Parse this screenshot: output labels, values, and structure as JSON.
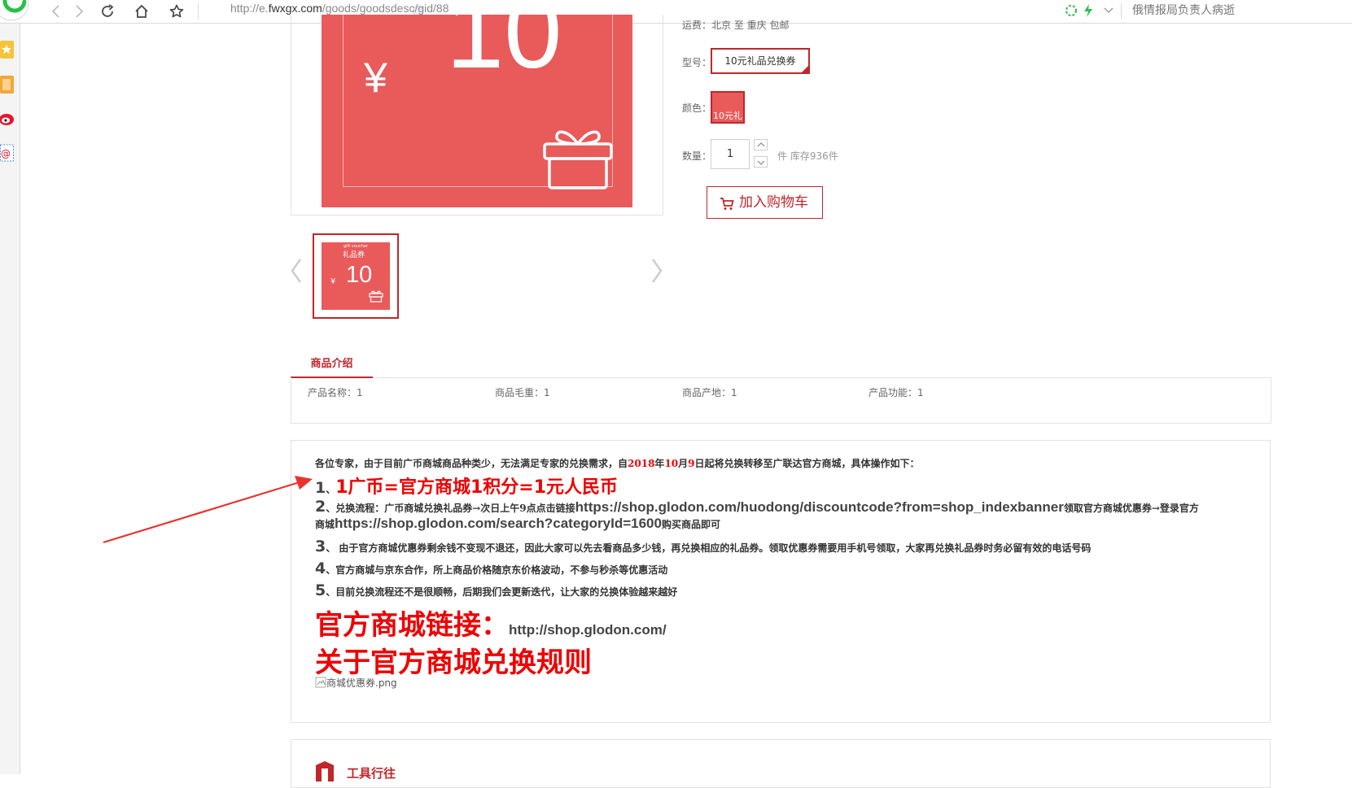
{
  "browser": {
    "url_prefix": "http://e.",
    "url_domain": "fwxgx.com",
    "url_path": "/goods/goodsdesc/gid/88",
    "news_text": "俄情报局负责人病逝"
  },
  "product": {
    "image": {
      "yen_symbol": "¥",
      "amount": "10"
    },
    "shipping": {
      "text": "运费：北京 至 重庆 包邮"
    },
    "model": {
      "label": "型号：",
      "value": "10元礼品兑换券"
    },
    "color": {
      "label": "颜色：",
      "value": "10元礼"
    },
    "quantity": {
      "label": "数量：",
      "value": "1",
      "stock": "件 库存936件"
    },
    "cart_button": "加入购物车",
    "thumbnail": {
      "top_text": "gift voucher",
      "title": "礼品券",
      "yen_symbol": "¥",
      "amount": "10"
    }
  },
  "tabs": {
    "intro": "商品介绍"
  },
  "attributes": [
    {
      "label": "产品名称：1"
    },
    {
      "label": "商品毛重：1"
    },
    {
      "label": "商品产地：1"
    },
    {
      "label": "产品功能：1"
    }
  ],
  "notice": {
    "intro_a": "各位专家，由于目前广币商城商品种类少，无法满足专家的兑换需求，自",
    "intro_year": "2018",
    "intro_b": "年",
    "intro_month": "10",
    "intro_c": "月",
    "intro_day": "9",
    "intro_d": "日起将兑换转移至广联达官方商城，具体操作如下：",
    "item1_num": "1",
    "item1_sep": "、",
    "item1_text": "1广币=官方商城1积分=1元人民币",
    "item2_num": "2",
    "item2_a": "、兑换流程：广币商城兑换礼品券→次日上午9点点击链接",
    "item2_url1": "https://shop.glodon.com/huodong/discountcode?from=shop_indexbanner",
    "item2_b": "领取官方商城优惠券→登录官方",
    "item2_c": "商城",
    "item2_url2": "https://shop.glodon.com/search?categoryId=1600",
    "item2_d": "购买商品即可",
    "item3_num": "3",
    "item3_text": "、 由于官方商城优惠券剩余钱不变现不退还，因此大家可以先去看商品多少钱，再兑换相应的礼品券。领取优惠券需要用手机号领取，大家再兑换礼品券时务必留有效的电话号码",
    "item4_num": "4",
    "item4_text": "、官方商城与京东合作，所上商品价格随京东价格波动，不参与秒杀等优惠活动",
    "item5_num": "5",
    "item5_text": "、目前兑换流程还不是很顺畅，后期我们会更新迭代，让大家的兑换体验越来越好",
    "link_title": "官方商城链接：",
    "link_url": "http://shop.glodon.com/",
    "rules_title": "关于官方商城兑换规则",
    "image_alt": "商城优惠券.png"
  },
  "bottom": {
    "title": "工具行往"
  },
  "colors": {
    "accent": "#c0262b",
    "voucher": "#e95a5b",
    "highlight": "#ee0000",
    "annotation_arrow": "#e8332e"
  }
}
